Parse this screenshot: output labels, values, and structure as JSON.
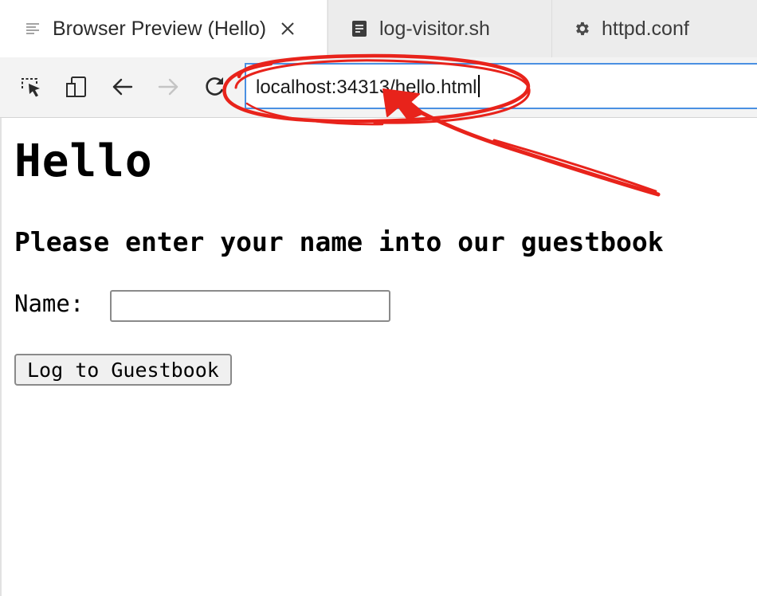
{
  "tabs": [
    {
      "label": "Browser Preview (Hello)",
      "icon": "preview-lines-icon",
      "active": true,
      "closable": true
    },
    {
      "label": "log-visitor.sh",
      "icon": "document-icon",
      "active": false
    },
    {
      "label": "httpd.conf",
      "icon": "gear-icon",
      "active": false
    }
  ],
  "toolbar": {
    "buttons": [
      "inspect-select-icon",
      "device-toggle-icon",
      "back-arrow-icon",
      "forward-arrow-icon",
      "reload-icon"
    ],
    "url": "localhost:34313/hello.html"
  },
  "page": {
    "heading": "Hello",
    "subheading": "Please enter your name into our guestbook",
    "name_label": "Name:",
    "name_value": "",
    "submit_label": "Log to Guestbook"
  },
  "colors": {
    "annotation": "#e8231b",
    "url_focus_border": "#4a90e2",
    "tabbar_bg": "#ececec"
  }
}
